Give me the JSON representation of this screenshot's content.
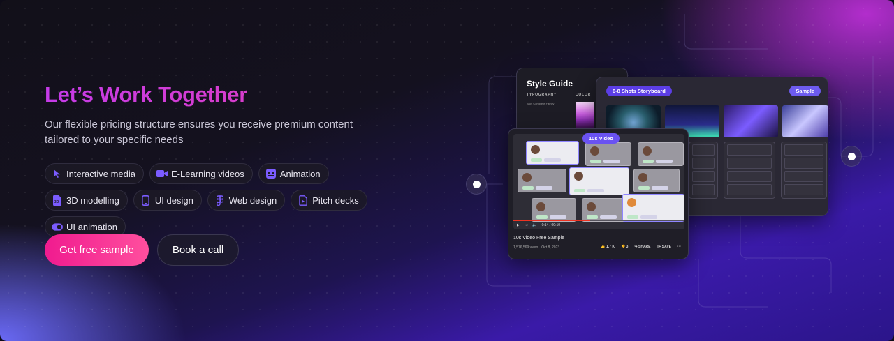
{
  "hero": {
    "title": "Let’s Work Together",
    "subtitle": "Our flexible pricing structure ensures you receive premium content tailored to your specific needs"
  },
  "services": [
    {
      "label": "Interactive media",
      "icon": "cursor-icon"
    },
    {
      "label": "E-Learning videos",
      "icon": "video-camera-icon"
    },
    {
      "label": "Animation",
      "icon": "animation-icon"
    },
    {
      "label": "3D modelling",
      "icon": "3d-file-icon"
    },
    {
      "label": "UI design",
      "icon": "phone-icon"
    },
    {
      "label": "Web design",
      "icon": "figma-icon"
    },
    {
      "label": "Pitch decks",
      "icon": "presentation-file-icon"
    },
    {
      "label": "UI animation",
      "icon": "toggle-icon"
    }
  ],
  "cta": {
    "primary": "Get free sample",
    "secondary": "Book a call"
  },
  "colors": {
    "accent_pink": "#f01b8f",
    "accent_purple": "#6a52f2",
    "title_gradient_start": "#c53be8"
  },
  "preview": {
    "style_guide": {
      "title": "Style Guide",
      "typography_label": "TYPOGRAPHY",
      "color_label": "COLOR",
      "font_name": "Jaks Complete Family"
    },
    "storyboard": {
      "tag": "6-8 Shots Storyboard",
      "sample": "Sample"
    },
    "video": {
      "tag": "10s Video",
      "title": "10s Video Free Sample",
      "meta": "1,576,569 views . Oct 8, 2023",
      "likes": "1.7 K",
      "dislikes": "3",
      "share": "SHARE",
      "save": "SAVE",
      "time": "0:14 / 00:10"
    }
  }
}
